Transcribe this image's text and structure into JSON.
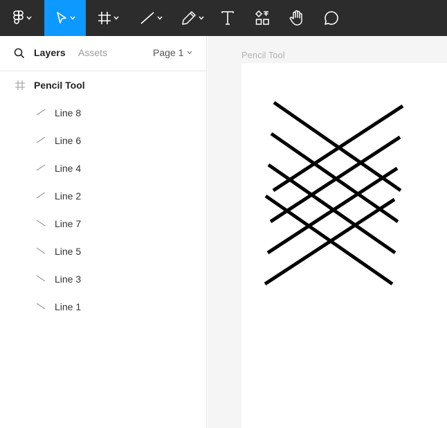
{
  "toolbar": {
    "tools": [
      {
        "name": "main-menu",
        "icon": "figma-logo-icon"
      },
      {
        "name": "move-tool",
        "icon": "cursor-arrow-icon",
        "active": true
      },
      {
        "name": "frame-tool",
        "icon": "frame-hash-icon"
      },
      {
        "name": "line-tool",
        "icon": "line-icon"
      },
      {
        "name": "pen-tool",
        "icon": "pen-icon"
      },
      {
        "name": "text-tool",
        "icon": "text-T-icon"
      },
      {
        "name": "resources-tool",
        "icon": "shapes-grid-icon"
      },
      {
        "name": "hand-tool",
        "icon": "hand-icon"
      },
      {
        "name": "comment-tool",
        "icon": "speech-bubble-icon"
      }
    ],
    "background": "#2c2c2c",
    "active_color": "#0d99ff"
  },
  "panel": {
    "tabs": {
      "layers": "Layers",
      "assets": "Assets"
    },
    "page": "Page 1",
    "frame": {
      "label": "Pencil Tool",
      "icon": "frame-hash-icon"
    },
    "layers": [
      {
        "label": "Line 8",
        "icon": "line-up-icon"
      },
      {
        "label": "Line 6",
        "icon": "line-up-icon"
      },
      {
        "label": "Line 4",
        "icon": "line-up-icon"
      },
      {
        "label": "Line 2",
        "icon": "line-up-icon"
      },
      {
        "label": "Line 7",
        "icon": "line-down-icon"
      },
      {
        "label": "Line 5",
        "icon": "line-down-icon"
      },
      {
        "label": "Line 3",
        "icon": "line-down-icon"
      },
      {
        "label": "Line 1",
        "icon": "line-down-icon"
      }
    ]
  },
  "canvas": {
    "frame_title": "Pencil Tool",
    "background": "#f5f5f5",
    "stroke_color": "#000000"
  }
}
